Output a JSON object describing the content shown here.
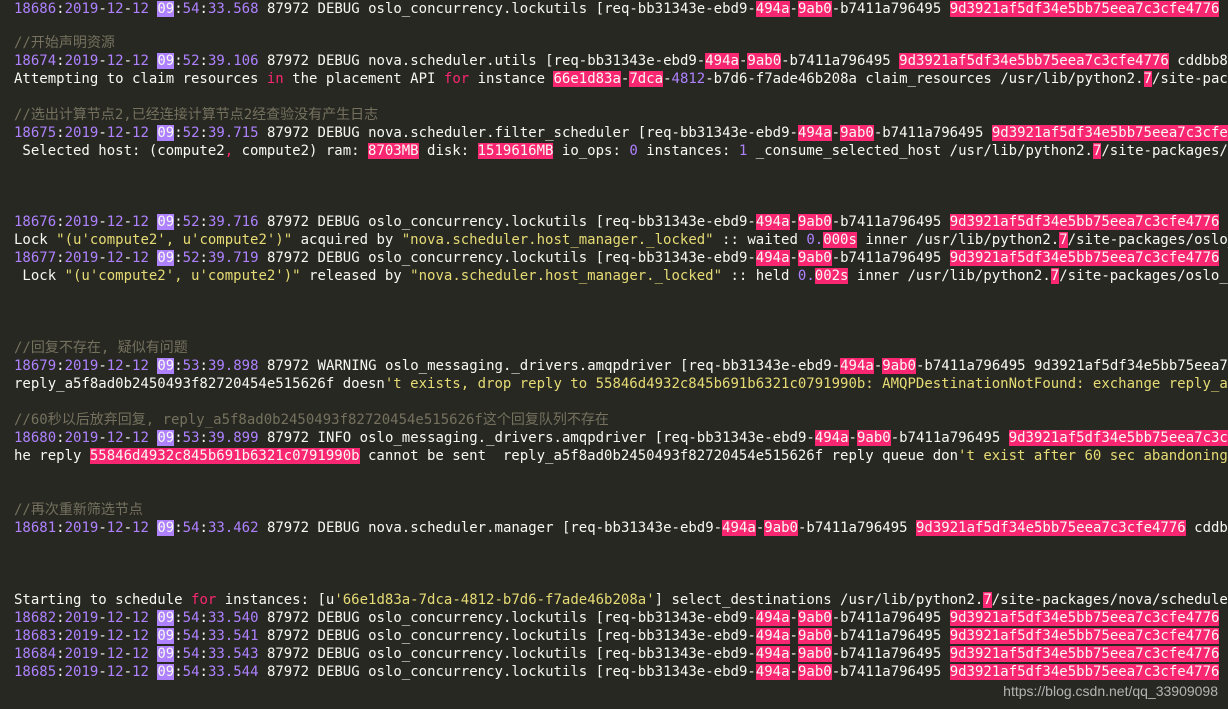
{
  "lines": [
    {
      "segs": [
        [
          "//开始声明资源",
          "c"
        ]
      ]
    },
    {
      "segs": [
        [
          "18674",
          "n"
        ],
        [
          ":",
          ""
        ],
        [
          "2019",
          "n"
        ],
        [
          "-",
          ""
        ],
        [
          "12",
          "n"
        ],
        [
          "-",
          ""
        ],
        [
          "12",
          "n"
        ],
        [
          " ",
          ""
        ],
        [
          "09",
          "hlp"
        ],
        [
          ":",
          ""
        ],
        [
          "52",
          "n"
        ],
        [
          ":",
          ""
        ],
        [
          "39.106",
          "n"
        ],
        [
          " 87972 DEBUG nova.scheduler.utils [req-bb31343e-ebd9-",
          ""
        ],
        [
          "494a",
          "hl"
        ],
        [
          "-",
          ""
        ],
        [
          "9ab0",
          "hl"
        ],
        [
          "-b7411a796495 ",
          ""
        ],
        [
          "9d3921af5df34e5bb75eea7c3cfe4776",
          "hl"
        ],
        [
          " cddbb8e0ca",
          ""
        ]
      ]
    },
    {
      "segs": [
        [
          "Attempting to claim resources ",
          ""
        ],
        [
          "in",
          "k"
        ],
        [
          " the placement API ",
          ""
        ],
        [
          "for",
          "k"
        ],
        [
          " instance ",
          ""
        ],
        [
          "66e1d83a",
          "hl"
        ],
        [
          "-",
          ""
        ],
        [
          "7dca",
          "hl"
        ],
        [
          "-",
          ""
        ],
        [
          "4812",
          "n"
        ],
        [
          "-b7d6-f7ade46b208a claim_resources /usr/lib/python2.",
          ""
        ],
        [
          "7",
          "hl"
        ],
        [
          "/site-packages",
          ""
        ]
      ]
    },
    {
      "segs": [
        [
          "//选出计算节点2,已经连接计算节点2经查验没有产生日志",
          "c"
        ]
      ]
    },
    {
      "segs": [
        [
          "18675",
          "n"
        ],
        [
          ":",
          ""
        ],
        [
          "2019",
          "n"
        ],
        [
          "-",
          ""
        ],
        [
          "12",
          "n"
        ],
        [
          "-",
          ""
        ],
        [
          "12",
          "n"
        ],
        [
          " ",
          ""
        ],
        [
          "09",
          "hlp"
        ],
        [
          ":",
          ""
        ],
        [
          "52",
          "n"
        ],
        [
          ":",
          ""
        ],
        [
          "39.715",
          "n"
        ],
        [
          " 87972 DEBUG nova.scheduler.filter_scheduler [req-bb31343e-ebd9-",
          ""
        ],
        [
          "494a",
          "hl"
        ],
        [
          "-",
          ""
        ],
        [
          "9ab0",
          "hl"
        ],
        [
          "-b7411a796495 ",
          ""
        ],
        [
          "9d3921af5df34e5bb75eea7c3cfe4776",
          "hl"
        ]
      ]
    },
    {
      "segs": [
        [
          " Selected host: (compute2",
          ""
        ],
        [
          ",",
          "k"
        ],
        [
          " compute2) ram: ",
          ""
        ],
        [
          "8703MB",
          "hl"
        ],
        [
          " disk: ",
          ""
        ],
        [
          "1519616MB",
          "hl"
        ],
        [
          " io_ops: ",
          ""
        ],
        [
          "0",
          "n"
        ],
        [
          " instances: ",
          ""
        ],
        [
          "1",
          "n"
        ],
        [
          " _consume_selected_host /usr/lib/python2.",
          ""
        ],
        [
          "7",
          "hl"
        ],
        [
          "/site-packages/nova",
          ""
        ]
      ]
    },
    {
      "segs": [
        [
          "18676",
          "n"
        ],
        [
          ":",
          ""
        ],
        [
          "2019",
          "n"
        ],
        [
          "-",
          ""
        ],
        [
          "12",
          "n"
        ],
        [
          "-",
          ""
        ],
        [
          "12",
          "n"
        ],
        [
          " ",
          ""
        ],
        [
          "09",
          "hlp"
        ],
        [
          ":",
          ""
        ],
        [
          "52",
          "n"
        ],
        [
          ":",
          ""
        ],
        [
          "39.716",
          "n"
        ],
        [
          " 87972 DEBUG oslo_concurrency.lockutils [req-bb31343e-ebd9-",
          ""
        ],
        [
          "494a",
          "hl"
        ],
        [
          "-",
          ""
        ],
        [
          "9ab0",
          "hl"
        ],
        [
          "-b7411a796495 ",
          ""
        ],
        [
          "9d3921af5df34e5bb75eea7c3cfe4776",
          "hl"
        ],
        [
          " cddb",
          ""
        ]
      ]
    },
    {
      "segs": [
        [
          "Lock ",
          ""
        ],
        [
          "\"(u'compute2', u'compute2')\"",
          "s"
        ],
        [
          " acquired by ",
          ""
        ],
        [
          "\"nova.scheduler.host_manager._locked\"",
          "s"
        ],
        [
          " :: waited ",
          ""
        ],
        [
          "0.",
          "n"
        ],
        [
          "000s",
          "hl"
        ],
        [
          " inner /usr/lib/python2.",
          ""
        ],
        [
          "7",
          "hl"
        ],
        [
          "/site-packages/oslo_con",
          ""
        ]
      ]
    },
    {
      "segs": [
        [
          "18677",
          "n"
        ],
        [
          ":",
          ""
        ],
        [
          "2019",
          "n"
        ],
        [
          "-",
          ""
        ],
        [
          "12",
          "n"
        ],
        [
          "-",
          ""
        ],
        [
          "12",
          "n"
        ],
        [
          " ",
          ""
        ],
        [
          "09",
          "hlp"
        ],
        [
          ":",
          ""
        ],
        [
          "52",
          "n"
        ],
        [
          ":",
          ""
        ],
        [
          "39.719",
          "n"
        ],
        [
          " 87972 DEBUG oslo_concurrency.lockutils [req-bb31343e-ebd9-",
          ""
        ],
        [
          "494a",
          "hl"
        ],
        [
          "-",
          ""
        ],
        [
          "9ab0",
          "hl"
        ],
        [
          "-b7411a796495 ",
          ""
        ],
        [
          "9d3921af5df34e5bb75eea7c3cfe4776",
          "hl"
        ],
        [
          " cddb",
          ""
        ]
      ]
    },
    {
      "segs": [
        [
          " Lock ",
          ""
        ],
        [
          "\"(u'compute2', u'compute2')\"",
          "s"
        ],
        [
          " released by ",
          ""
        ],
        [
          "\"nova.scheduler.host_manager._locked\"",
          "s"
        ],
        [
          " :: held ",
          ""
        ],
        [
          "0.",
          "n"
        ],
        [
          "002s",
          "hl"
        ],
        [
          " inner /usr/lib/python2.",
          ""
        ],
        [
          "7",
          "hl"
        ],
        [
          "/site-packages/oslo_co",
          ""
        ]
      ]
    },
    {
      "segs": [
        [
          "//回复不存在, 疑似有问题",
          "c"
        ]
      ]
    },
    {
      "segs": [
        [
          "18679",
          "n"
        ],
        [
          ":",
          ""
        ],
        [
          "2019",
          "n"
        ],
        [
          "-",
          ""
        ],
        [
          "12",
          "n"
        ],
        [
          "-",
          ""
        ],
        [
          "12",
          "n"
        ],
        [
          " ",
          ""
        ],
        [
          "09",
          "hlp"
        ],
        [
          ":",
          ""
        ],
        [
          "53",
          "n"
        ],
        [
          ":",
          ""
        ],
        [
          "39.898",
          "n"
        ],
        [
          " 87972 WARNING oslo_messaging._drivers.amqpdriver [req-bb31343e-ebd9-",
          ""
        ],
        [
          "494a",
          "hl"
        ],
        [
          "-",
          ""
        ],
        [
          "9ab0",
          "hl"
        ],
        [
          "-b7411a796495 ",
          ""
        ],
        [
          "9d3921af5df34e5bb75eea7c3c",
          ""
        ]
      ]
    },
    {
      "segs": [
        [
          "reply_a5f8ad0b2450493f82720454e515626f doesn",
          ""
        ],
        [
          "'t exists, drop reply to 55846d4932c845b691b6321c0791990b: AMQPDestinationNotFound: exchange reply_a5f8",
          "s"
        ]
      ]
    },
    {
      "segs": [
        [
          "//60秒以后放弃回复, reply_a5f8ad0b2450493f82720454e515626f这个回复队列不存在",
          "c"
        ]
      ]
    },
    {
      "segs": [
        [
          "18680",
          "n"
        ],
        [
          ":",
          ""
        ],
        [
          "2019",
          "n"
        ],
        [
          "-",
          ""
        ],
        [
          "12",
          "n"
        ],
        [
          "-",
          ""
        ],
        [
          "12",
          "n"
        ],
        [
          " ",
          ""
        ],
        [
          "09",
          "hlp"
        ],
        [
          ":",
          ""
        ],
        [
          "53",
          "n"
        ],
        [
          ":",
          ""
        ],
        [
          "39.899",
          "n"
        ],
        [
          " 87972 INFO oslo_messaging._drivers.amqpdriver [req-bb31343e-ebd9-",
          ""
        ],
        [
          "494a",
          "hl"
        ],
        [
          "-",
          ""
        ],
        [
          "9ab0",
          "hl"
        ],
        [
          "-b7411a796495 ",
          ""
        ],
        [
          "9d3921af5df34e5bb75eea7c3cfe47",
          "hl"
        ]
      ]
    },
    {
      "segs": [
        [
          "he reply ",
          ""
        ],
        [
          "55846d4932c845b691b6321c0791990b",
          "hl"
        ],
        [
          " cannot be sent  reply_a5f8ad0b2450493f82720454e515626f reply queue don",
          ""
        ],
        [
          "'t exist after 60 sec abandoning...",
          "s"
        ]
      ]
    },
    {
      "segs": [
        [
          "//再次重新筛选节点",
          "c"
        ]
      ]
    },
    {
      "segs": [
        [
          "18681",
          "n"
        ],
        [
          ":",
          ""
        ],
        [
          "2019",
          "n"
        ],
        [
          "-",
          ""
        ],
        [
          "12",
          "n"
        ],
        [
          "-",
          ""
        ],
        [
          "12",
          "n"
        ],
        [
          " ",
          ""
        ],
        [
          "09",
          "hlp"
        ],
        [
          ":",
          ""
        ],
        [
          "54",
          "n"
        ],
        [
          ":",
          ""
        ],
        [
          "33.462",
          "n"
        ],
        [
          " 87972 DEBUG nova.scheduler.manager [req-bb31343e-ebd9-",
          ""
        ],
        [
          "494a",
          "hl"
        ],
        [
          "-",
          ""
        ],
        [
          "9ab0",
          "hl"
        ],
        [
          "-b7411a796495 ",
          ""
        ],
        [
          "9d3921af5df34e5bb75eea7c3cfe4776",
          "hl"
        ],
        [
          " cddbb8e0",
          ""
        ]
      ]
    },
    {
      "segs": [
        [
          "Starting to schedule ",
          ""
        ],
        [
          "for",
          "k"
        ],
        [
          " instances: [u",
          ""
        ],
        [
          "'66e1d83a-7dca-4812-b7d6-f7ade46b208a'",
          "s"
        ],
        [
          "] select_destinations /usr/lib/python2.",
          ""
        ],
        [
          "7",
          "hl"
        ],
        [
          "/site-packages/nova/scheduler/ma",
          ""
        ]
      ]
    },
    {
      "segs": [
        [
          "18682",
          "n"
        ],
        [
          ":",
          ""
        ],
        [
          "2019",
          "n"
        ],
        [
          "-",
          ""
        ],
        [
          "12",
          "n"
        ],
        [
          "-",
          ""
        ],
        [
          "12",
          "n"
        ],
        [
          " ",
          ""
        ],
        [
          "09",
          "hlp"
        ],
        [
          ":",
          ""
        ],
        [
          "54",
          "n"
        ],
        [
          ":",
          ""
        ],
        [
          "33.540",
          "n"
        ],
        [
          " 87972 DEBUG oslo_concurrency.lockutils [req-bb31343e-ebd9-",
          ""
        ],
        [
          "494a",
          "hl"
        ],
        [
          "-",
          ""
        ],
        [
          "9ab0",
          "hl"
        ],
        [
          "-b7411a796495 ",
          ""
        ],
        [
          "9d3921af5df34e5bb75eea7c3cfe4776",
          "hl"
        ],
        [
          " cddb",
          ""
        ]
      ]
    },
    {
      "segs": [
        [
          "18683",
          "n"
        ],
        [
          ":",
          ""
        ],
        [
          "2019",
          "n"
        ],
        [
          "-",
          ""
        ],
        [
          "12",
          "n"
        ],
        [
          "-",
          ""
        ],
        [
          "12",
          "n"
        ],
        [
          " ",
          ""
        ],
        [
          "09",
          "hlp"
        ],
        [
          ":",
          ""
        ],
        [
          "54",
          "n"
        ],
        [
          ":",
          ""
        ],
        [
          "33.541",
          "n"
        ],
        [
          " 87972 DEBUG oslo_concurrency.lockutils [req-bb31343e-ebd9-",
          ""
        ],
        [
          "494a",
          "hl"
        ],
        [
          "-",
          ""
        ],
        [
          "9ab0",
          "hl"
        ],
        [
          "-b7411a796495 ",
          ""
        ],
        [
          "9d3921af5df34e5bb75eea7c3cfe4776",
          "hl"
        ],
        [
          " cddb",
          ""
        ]
      ]
    },
    {
      "segs": [
        [
          "18684",
          "n"
        ],
        [
          ":",
          ""
        ],
        [
          "2019",
          "n"
        ],
        [
          "-",
          ""
        ],
        [
          "12",
          "n"
        ],
        [
          "-",
          ""
        ],
        [
          "12",
          "n"
        ],
        [
          " ",
          ""
        ],
        [
          "09",
          "hlp"
        ],
        [
          ":",
          ""
        ],
        [
          "54",
          "n"
        ],
        [
          ":",
          ""
        ],
        [
          "33.543",
          "n"
        ],
        [
          " 87972 DEBUG oslo_concurrency.lockutils [req-bb31343e-ebd9-",
          ""
        ],
        [
          "494a",
          "hl"
        ],
        [
          "-",
          ""
        ],
        [
          "9ab0",
          "hl"
        ],
        [
          "-b7411a796495 ",
          ""
        ],
        [
          "9d3921af5df34e5bb75eea7c3cfe4776",
          "hl"
        ],
        [
          " cddb",
          ""
        ]
      ]
    },
    {
      "segs": [
        [
          "18685",
          "n"
        ],
        [
          ":",
          ""
        ],
        [
          "2019",
          "n"
        ],
        [
          "-",
          ""
        ],
        [
          "12",
          "n"
        ],
        [
          "-",
          ""
        ],
        [
          "12",
          "n"
        ],
        [
          " ",
          ""
        ],
        [
          "09",
          "hlp"
        ],
        [
          ":",
          ""
        ],
        [
          "54",
          "n"
        ],
        [
          ":",
          ""
        ],
        [
          "33.544",
          "n"
        ],
        [
          " 87972 DEBUG oslo_concurrency.lockutils [req-bb31343e-ebd9-",
          ""
        ],
        [
          "494a",
          "hl"
        ],
        [
          "-",
          ""
        ],
        [
          "9ab0",
          "hl"
        ],
        [
          "-b7411a796495 ",
          ""
        ],
        [
          "9d3921af5df34e5bb75eea7c3cfe4776",
          "hl"
        ],
        [
          " cddb",
          ""
        ]
      ]
    },
    {
      "segs": [
        [
          "18686",
          "n"
        ],
        [
          ":",
          ""
        ],
        [
          "2019",
          "n"
        ],
        [
          "-",
          ""
        ],
        [
          "12",
          "n"
        ],
        [
          "-",
          ""
        ],
        [
          "12",
          "n"
        ],
        [
          " ",
          ""
        ],
        [
          "09",
          "hlp"
        ],
        [
          ":",
          ""
        ],
        [
          "54",
          "n"
        ],
        [
          ":",
          ""
        ],
        [
          "33.568",
          "n"
        ],
        [
          " 87972 DEBUG oslo_concurrency.lockutils [req-bb31343e-ebd9-",
          ""
        ],
        [
          "494a",
          "hl"
        ],
        [
          "-",
          ""
        ],
        [
          "9ab0",
          "hl"
        ],
        [
          "-b7411a796495 ",
          ""
        ],
        [
          "9d3921af5df34e5bb75eea7c3cfe4776",
          "hl"
        ],
        [
          " cddb",
          ""
        ]
      ]
    }
  ],
  "watermark": "https://blog.csdn.net/qq_33909098",
  "colors": {
    "background": "#272822",
    "highlight": "#f92672",
    "number": "#ae81ff",
    "comment": "#75715e",
    "string": "#e6db74"
  }
}
